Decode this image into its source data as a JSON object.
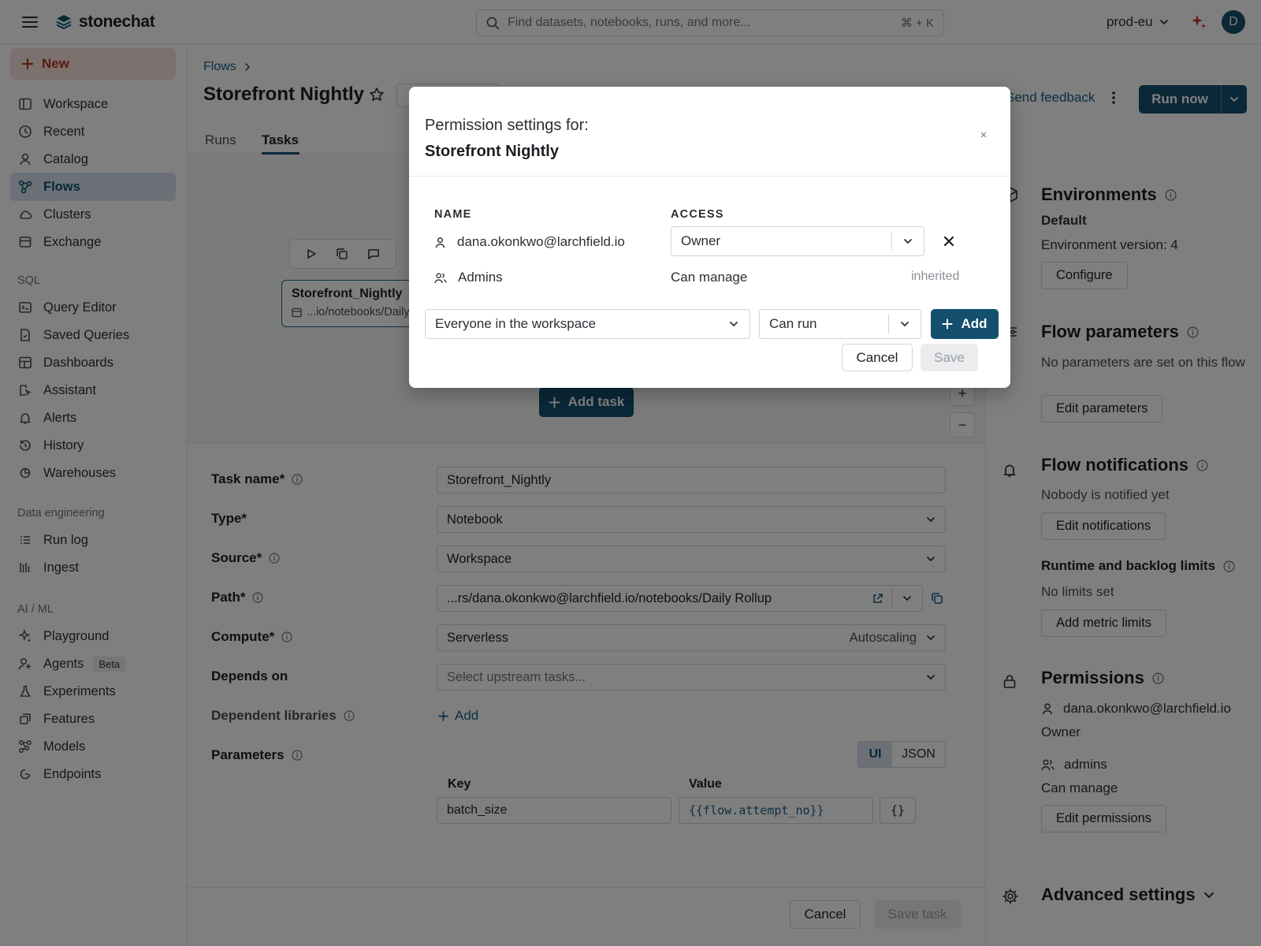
{
  "app": {
    "name": "stonechat",
    "search_placeholder": "Find datasets, notebooks, runs, and more...",
    "search_shortcut": "⌘ + K",
    "workspace": "prod-eu",
    "avatar_initial": "D",
    "accent": "#14506e"
  },
  "sidebar": {
    "new_label": "New",
    "main_items": [
      {
        "label": "Workspace",
        "icon": "workspace-icon"
      },
      {
        "label": "Recent",
        "icon": "clock-icon"
      },
      {
        "label": "Catalog",
        "icon": "catalog-icon"
      },
      {
        "label": "Flows",
        "icon": "flows-icon",
        "active": true
      },
      {
        "label": "Clusters",
        "icon": "cloud-icon"
      },
      {
        "label": "Exchange",
        "icon": "exchange-icon"
      }
    ],
    "sql_heading": "SQL",
    "sql_items": [
      {
        "label": "Query Editor"
      },
      {
        "label": "Saved Queries"
      },
      {
        "label": "Dashboards"
      },
      {
        "label": "Assistant"
      },
      {
        "label": "Alerts"
      },
      {
        "label": "History"
      },
      {
        "label": "Warehouses"
      }
    ],
    "de_heading": "Data engineering",
    "de_items": [
      {
        "label": "Run log"
      },
      {
        "label": "Ingest"
      }
    ],
    "ai_heading": "AI / ML",
    "ai_items": [
      {
        "label": "Playground"
      },
      {
        "label": "Agents",
        "badge": "Beta"
      },
      {
        "label": "Experiments"
      },
      {
        "label": "Features"
      },
      {
        "label": "Models"
      },
      {
        "label": "Endpoints"
      }
    ]
  },
  "header": {
    "breadcrumb": "Flows",
    "title": "Storefront Nightly",
    "feedback": "Send feedback",
    "run_now": "Run now"
  },
  "tabs": [
    {
      "label": "Runs"
    },
    {
      "label": "Tasks",
      "active": true
    }
  ],
  "canvas": {
    "node_title": "Storefront_Nightly",
    "node_path": "...io/notebooks/Daily Rollup",
    "add_task": "Add task"
  },
  "form": {
    "task_name_label": "Task name*",
    "task_name_value": "Storefront_Nightly",
    "type_label": "Type*",
    "type_value": "Notebook",
    "source_label": "Source*",
    "source_value": "Workspace",
    "path_label": "Path*",
    "path_value": "...rs/dana.okonkwo@larchfield.io/notebooks/Daily Rollup",
    "compute_label": "Compute*",
    "compute_value": "Serverless",
    "compute_mode": "Autoscaling",
    "depends_label": "Depends on",
    "depends_placeholder": "Select upstream tasks...",
    "libs_label": "Dependent libraries",
    "libs_add": "Add",
    "params_label": "Parameters",
    "params_ui": "UI",
    "params_json": "JSON",
    "key_head": "Key",
    "value_head": "Value",
    "param_key": "batch_size",
    "param_value": "{{flow.attempt_no}}",
    "brace": "{}",
    "cancel": "Cancel",
    "save_task": "Save task"
  },
  "right": {
    "env_title": "Environments",
    "env_name": "Default",
    "env_version": "Environment version: 4",
    "configure": "Configure",
    "params_title": "Flow parameters",
    "params_text": "No parameters are set on this flow",
    "edit_params": "Edit parameters",
    "notif_title": "Flow notifications",
    "notif_text": "Nobody is notified yet",
    "edit_notif": "Edit notifications",
    "limits_title": "Runtime and backlog limits",
    "limits_text": "No limits set",
    "add_limits": "Add metric limits",
    "perm_title": "Permissions",
    "perm_user": "dana.okonkwo@larchfield.io",
    "perm_user_role": "Owner",
    "perm_group": "admins",
    "perm_group_role": "Can manage",
    "edit_perm": "Edit permissions",
    "adv_title": "Advanced settings"
  },
  "modal": {
    "subtitle": "Permission settings for:",
    "title": "Storefront Nightly",
    "col_name": "NAME",
    "col_access": "ACCESS",
    "row1_name": "dana.okonkwo@larchfield.io",
    "row1_access": "Owner",
    "row2_name": "Admins",
    "row2_access": "Can manage",
    "row2_note": "inherited",
    "principal_select": "Everyone in the workspace",
    "access_select": "Can run",
    "add": "Add",
    "cancel": "Cancel",
    "save": "Save"
  }
}
